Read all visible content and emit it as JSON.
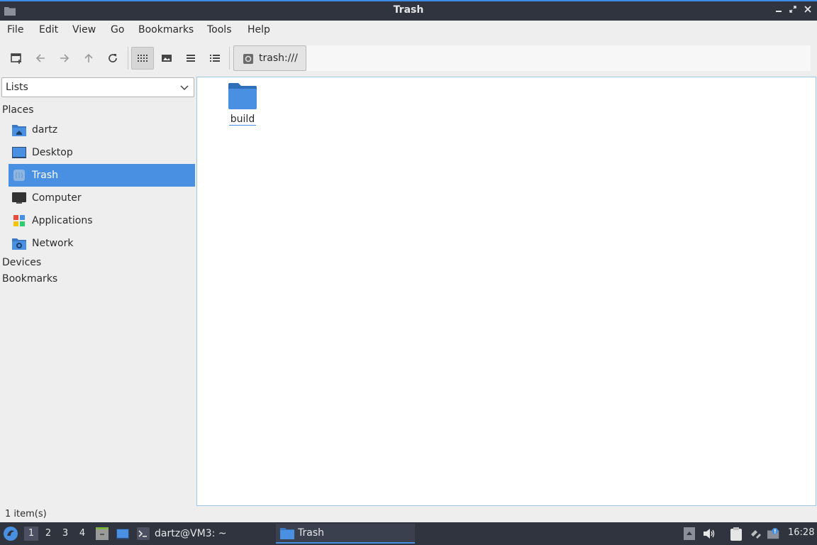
{
  "window": {
    "title": "Trash"
  },
  "menubar": {
    "items": [
      "File",
      "Edit",
      "View",
      "Go",
      "Bookmarks",
      "Tools",
      "Help"
    ]
  },
  "toolbar": {
    "path": "trash:///"
  },
  "sidebar": {
    "selector_value": "Lists",
    "places_header": "Places",
    "items": [
      {
        "label": "dartz",
        "icon": "home-folder-icon"
      },
      {
        "label": "Desktop",
        "icon": "desktop-icon"
      },
      {
        "label": "Trash",
        "icon": "trash-icon"
      },
      {
        "label": "Computer",
        "icon": "computer-icon"
      },
      {
        "label": "Applications",
        "icon": "applications-icon"
      },
      {
        "label": "Network",
        "icon": "network-icon"
      }
    ],
    "devices_header": "Devices",
    "bookmarks_header": "Bookmarks"
  },
  "main": {
    "files": [
      {
        "name": "build",
        "icon": "folder-icon"
      }
    ]
  },
  "statusbar": {
    "text": "1 item(s)"
  },
  "taskbar": {
    "workspaces": [
      "1",
      "2",
      "3",
      "4"
    ],
    "tasks": [
      {
        "label": "dartz@VM3: ~",
        "icon": "terminal-icon"
      },
      {
        "label": "Trash",
        "icon": "folder-icon"
      }
    ],
    "clock": "16:28"
  },
  "colors": {
    "accent": "#4a90e2",
    "titlebar": "#2f343f",
    "folder": "#4a90e2"
  }
}
